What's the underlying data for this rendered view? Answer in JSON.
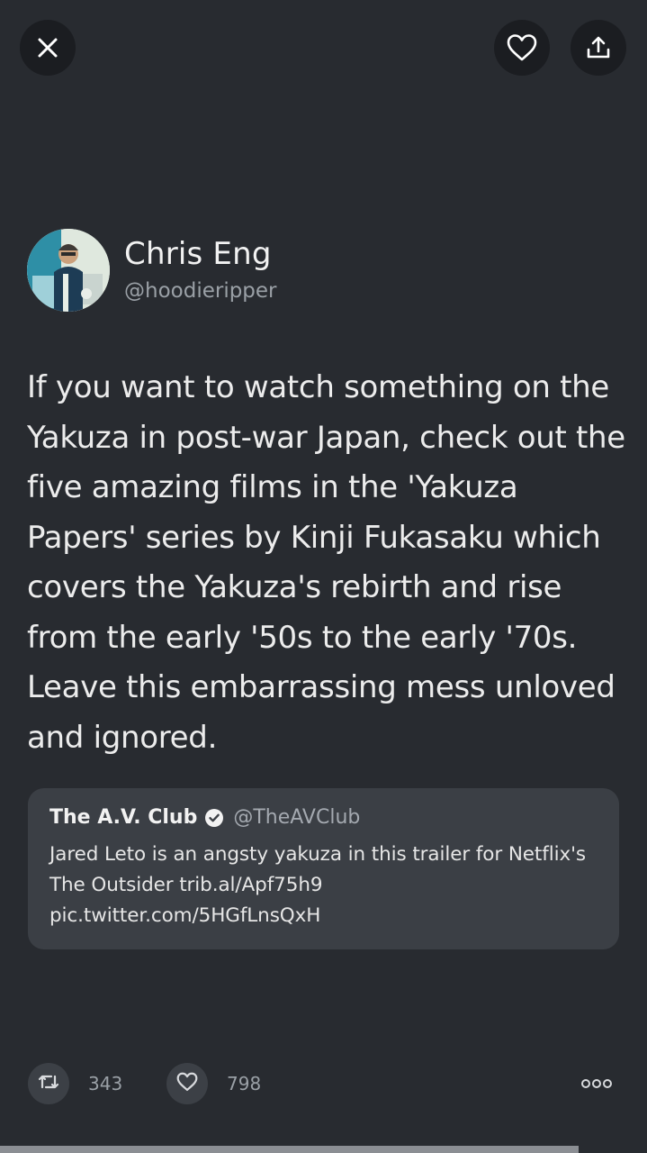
{
  "header": {
    "close_icon": "close-icon",
    "like_icon": "heart-icon",
    "share_icon": "share-icon"
  },
  "author": {
    "display_name": "Chris Eng",
    "handle": "@hoodieripper"
  },
  "tweet": {
    "text": "If you want to watch something on the Yakuza in post-war Japan, check out the five amazing films in the 'Yakuza Papers' series by Kinji Fukasaku which covers the Yakuza's rebirth and rise from the early '50s to the early '70s. Leave this embarrassing mess unloved and ignored."
  },
  "quoted_tweet": {
    "name": "The A.V. Club",
    "verified": true,
    "handle": "@TheAVClub",
    "text": "Jared Leto is an angsty yakuza in this trailer for Netflix's The Outsider trib.al/Apf75h9 pic.twitter.com/5HGfLnsQxH"
  },
  "actions": {
    "retweet_count": "343",
    "like_count": "798"
  },
  "colors": {
    "background": "#282b30",
    "quote_background": "#3b3f45",
    "secondary_text": "#9aa0a6"
  }
}
